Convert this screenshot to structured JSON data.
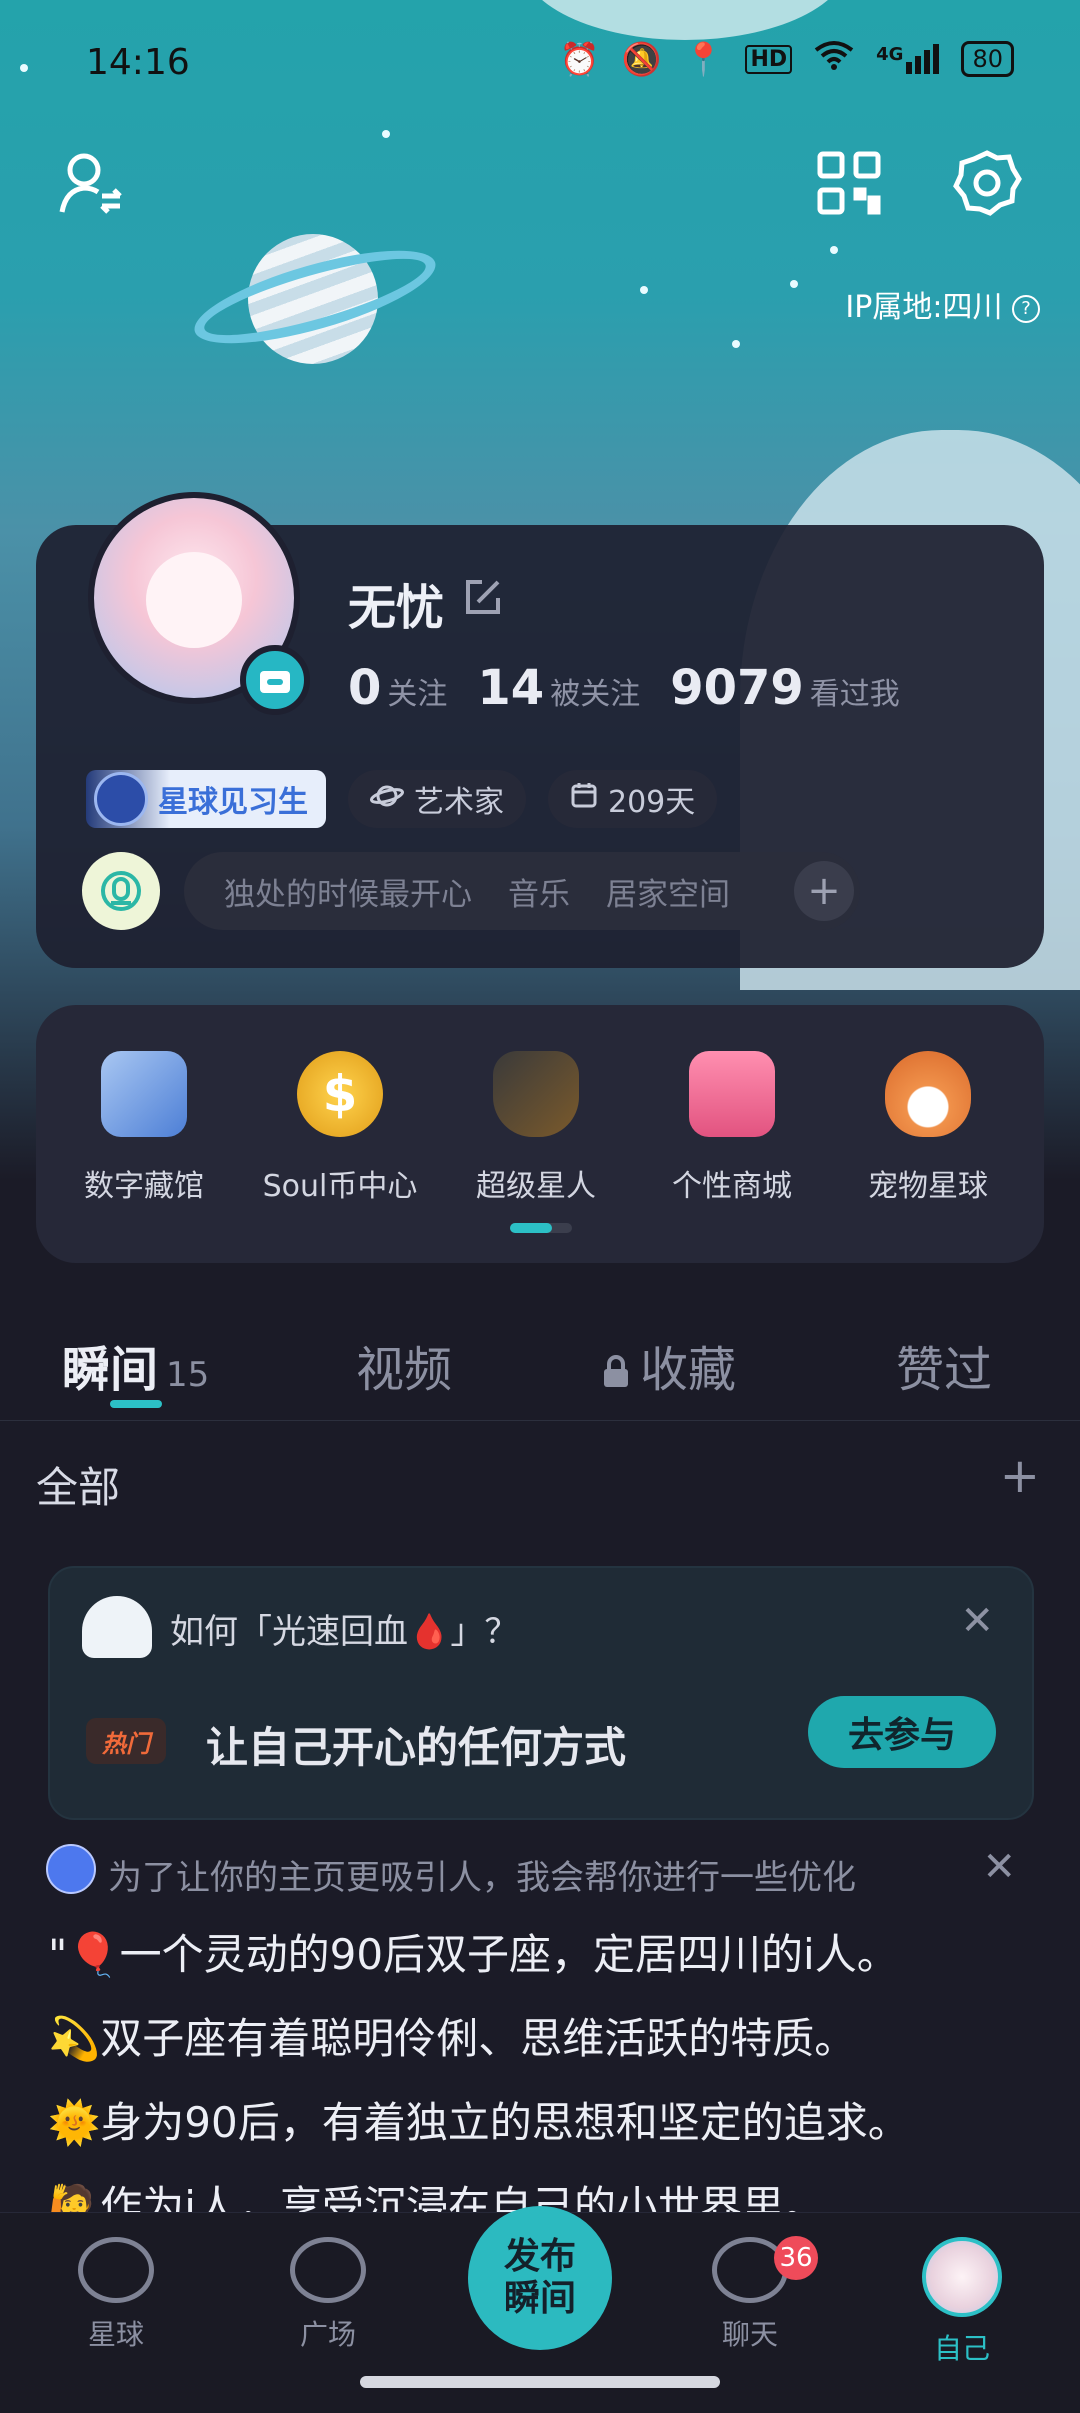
{
  "status_bar": {
    "time": "14:16",
    "icons": [
      "alarm-icon",
      "mute-icon",
      "location-icon",
      "hd-icon",
      "wifi-icon",
      "signal-icon"
    ],
    "network": "4G",
    "hd": "HD",
    "battery": "80"
  },
  "header": {
    "ip_location": "IP属地:四川"
  },
  "profile": {
    "name": "无忧",
    "following_count": "0",
    "following_label": "关注",
    "followers_count": "14",
    "followers_label": "被关注",
    "visitors_count": "9079",
    "visitors_label": "看过我",
    "level_badge": "星球见习生",
    "role_chip": "艺术家",
    "days_chip": "209天",
    "tags": [
      "独处的时候最开心",
      "音乐",
      "居家空间"
    ],
    "add_tag": "+"
  },
  "services": [
    {
      "label": "数字藏馆",
      "color": "#7ca8e8"
    },
    {
      "label": "Soul币中心",
      "color": "#f1bb2c"
    },
    {
      "label": "超级星人",
      "color": "#d7963a"
    },
    {
      "label": "个性商城",
      "color": "#ef7297"
    },
    {
      "label": "宠物星球",
      "color": "#e98a42"
    }
  ],
  "tabs": {
    "moments": "瞬间",
    "moments_count": "15",
    "video": "视频",
    "favorites": "收藏",
    "liked": "赞过"
  },
  "filter": {
    "label": "全部",
    "add": "+"
  },
  "topic_card": {
    "question": "如何「光速回血🩸」？",
    "close": "✕",
    "hot_label": "热门",
    "title": "让自己开心的任何方式",
    "join_button": "去参与"
  },
  "ai_tip": {
    "text": "为了让你的主页更吸引人，我会帮你进行一些优化",
    "close": "✕"
  },
  "bio_lines": [
    "\"🎈一个灵动的90后双子座，定居四川的i人。",
    "💫双子座有着聪明伶俐、思维活跃的特质。",
    "🌞身为90后，有着独立的思想和坚定的追求。",
    "🙋作为i人，享受沉浸在自己的小世界里。"
  ],
  "nav": {
    "planet": "星球",
    "square": "广场",
    "publish_line1": "发布",
    "publish_line2": "瞬间",
    "chat": "聊天",
    "chat_badge": "36",
    "me": "自己"
  }
}
